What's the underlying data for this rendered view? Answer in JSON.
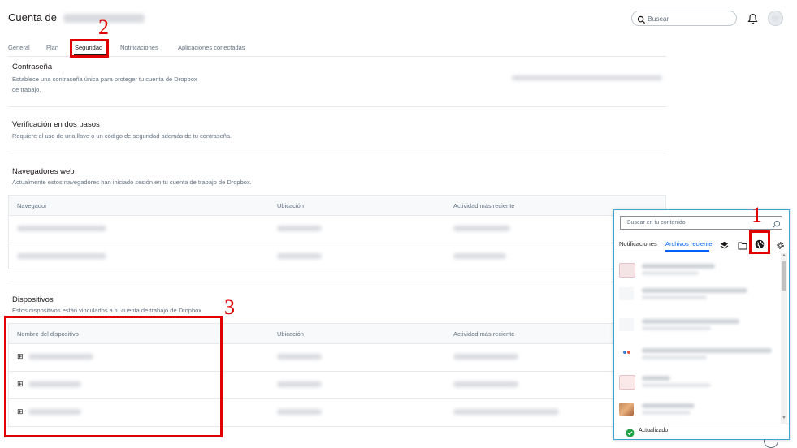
{
  "header": {
    "title": "Cuenta de",
    "search_placeholder": "Buscar"
  },
  "tabs": [
    {
      "label": "General"
    },
    {
      "label": "Plan"
    },
    {
      "label": "Seguridad"
    },
    {
      "label": "Notificaciones"
    },
    {
      "label": "Aplicaciones conectadas"
    }
  ],
  "password": {
    "title": "Contraseña",
    "desc_line1": "Establece una contraseña única para proteger tu cuenta de Dropbox",
    "desc_line2": "de trabajo."
  },
  "two_step": {
    "title": "Verificación en dos pasos",
    "desc": "Requiere el uso de una llave o un código de seguridad además de tu contraseña."
  },
  "browsers": {
    "title": "Navegadores web",
    "desc": "Actualmente estos navegadores han iniciado sesión en tu cuenta de trabajo de Dropbox.",
    "col_browser": "Navegador",
    "col_location": "Ubicación",
    "col_activity": "Actividad más reciente"
  },
  "devices": {
    "title": "Dispositivos",
    "desc": "Estos dispositivos están vinculados a tu cuenta de trabajo de Dropbox.",
    "col_name": "Nombre del dispositivo",
    "col_location": "Ubicación",
    "col_activity": "Actividad más reciente"
  },
  "panel": {
    "search_placeholder": "Buscar en tu contenido",
    "tab_notifications": "Notificaciones",
    "tab_recent": "Archivos reciente",
    "status": "Actualizado"
  },
  "annotations": {
    "n1": "1",
    "n2": "2",
    "n3": "3"
  },
  "colors": {
    "accent": "#0061fe",
    "annotation_red": "#e00000",
    "status_green": "#1fa145"
  }
}
